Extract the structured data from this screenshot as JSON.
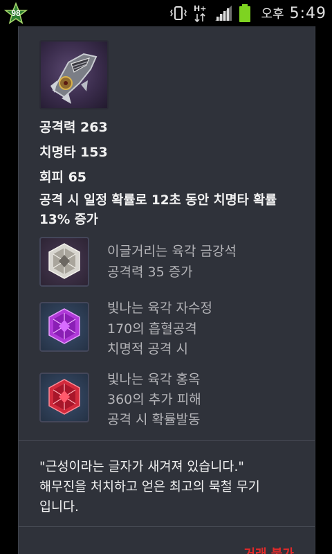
{
  "status_bar": {
    "badge_count": "98",
    "ampm": "오후",
    "time": "5:49",
    "icons": [
      "star-badge-icon",
      "vibrate-icon",
      "hplus-data-icon",
      "signal-icon",
      "battery-icon"
    ]
  },
  "item": {
    "icon": "gauntlet-weapon-icon",
    "stats": [
      {
        "text": "공격력 263"
      },
      {
        "text": "치명타 153"
      },
      {
        "text": "회피 65"
      }
    ],
    "description": "공격 시 일정 확률로 12초 동안 치명타 확률 13% 증가",
    "gems": [
      {
        "icon": "white-hexagon-gem-icon",
        "name": "이글거리는 육각 금강석",
        "effects": [
          "공격력 35 증가"
        ]
      },
      {
        "icon": "purple-hexagon-gem-icon",
        "name": "빛나는 육각 자수정",
        "effects": [
          "170의 흡혈공격",
          "치명적 공격 시"
        ]
      },
      {
        "icon": "red-hexagon-gem-icon",
        "name": "빛나는 육각 홍옥",
        "effects": [
          "360의 추가 피해",
          "공격 시 확률발동"
        ]
      }
    ],
    "lore_lines": [
      "\"근성이라는 글자가 새겨져 있습니다.\"",
      "해무진을 처치하고 얻은 최고의 묵철 무기",
      "입니다."
    ],
    "trade_status": "거래 불가"
  },
  "colors": {
    "panel_bg": "#2f323a",
    "stat_text": "#f2f2f2",
    "gem_text": "#b4b4b8",
    "trade_red": "#e02a2a",
    "battery_green": "#7ed321"
  }
}
